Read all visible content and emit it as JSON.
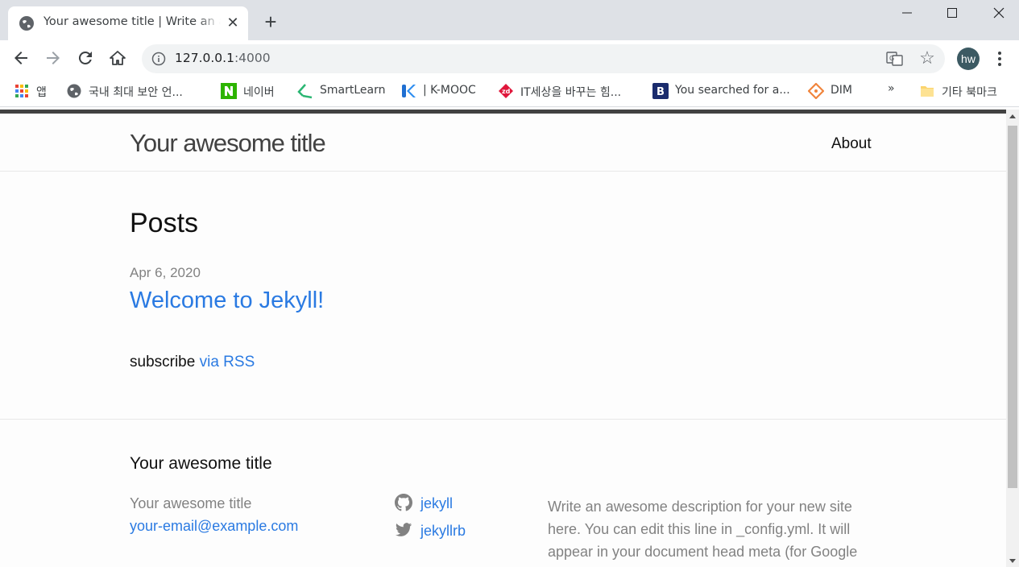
{
  "browser": {
    "tab": {
      "title": "Your awesome title | Write an awesome description for your new site here.",
      "close_glyph": "✕"
    },
    "new_tab_glyph": "+",
    "window_controls": {
      "minimize": "—",
      "maximize": "☐",
      "close": "✕"
    },
    "address": {
      "host": "127.0.0.1",
      "port": ":4000"
    },
    "profile_initials": "hw",
    "bookmarks": [
      {
        "label": "앱",
        "icon": "apps-grid-icon"
      },
      {
        "label": "국내 최대 보안 언...",
        "icon": "globe-icon"
      },
      {
        "label": "네이버",
        "icon": "naver-icon"
      },
      {
        "label": "SmartLearn",
        "icon": "smartlearn-icon"
      },
      {
        "label": "| K-MOOC",
        "icon": "kmooc-icon"
      },
      {
        "label": "IT세상을 바꾸는 힘...",
        "icon": "zdnet-icon"
      },
      {
        "label": "You searched for a...",
        "icon": "b-icon"
      },
      {
        "label": "DIM",
        "icon": "dim-icon"
      }
    ],
    "bookmarks_overflow": "»",
    "other_bookmarks": "기타 북마크"
  },
  "site": {
    "title": "Your awesome title",
    "nav": {
      "about": "About"
    },
    "posts_heading": "Posts",
    "posts": [
      {
        "date": "Apr 6, 2020",
        "title": "Welcome to Jekyll!"
      }
    ],
    "rss": {
      "prefix": "subscribe",
      "link": "via RSS"
    },
    "footer": {
      "heading": "Your awesome title",
      "name": "Your awesome title",
      "email": "your-email@example.com",
      "github": "jekyll",
      "twitter": "jekyllrb",
      "description": "Write an awesome description for your new site here. You can edit this line in _config.yml. It will appear in your document head meta (for Google search results) and in your feed.xml site description."
    }
  },
  "colors": {
    "link": "#2a7ae2",
    "meta": "#828282",
    "text": "#111111",
    "header_bar": "#424242"
  }
}
